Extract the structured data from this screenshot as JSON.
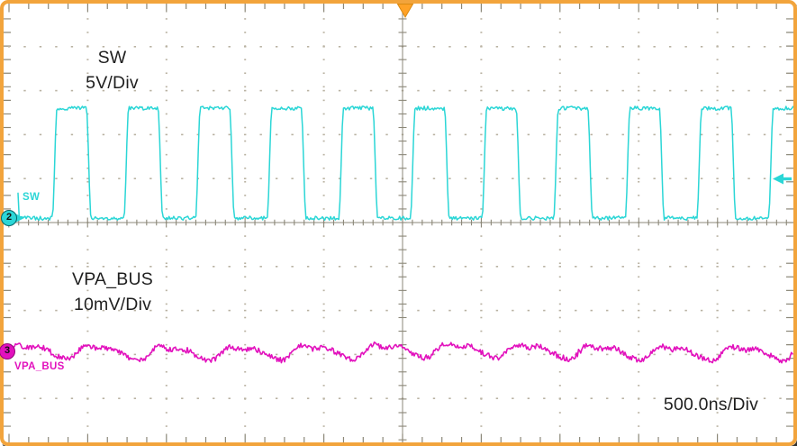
{
  "labels": {
    "ch2_annotation_line1": "SW",
    "ch2_annotation_line2": "5V/Div",
    "ch3_annotation_line1": "VPA_BUS",
    "ch3_annotation_line2": "10mV/Div",
    "timebase": "500.0ns/Div",
    "ch2_trace_label": "SW",
    "ch3_trace_label": "VPA_BUS",
    "ch2_marker": "2",
    "ch3_marker": "3"
  },
  "colors": {
    "ch2": "#2bd6d6",
    "ch3": "#e211bd",
    "frame": "#f2a43c",
    "trigger": "#ffa226",
    "trigger-edge": "#d98a12",
    "grid-tick": "#8b8778",
    "grid-dot": "#b9b2a2",
    "text": "#1f1f1f"
  },
  "chart_data": {
    "type": "line",
    "title": "Oscilloscope capture: SW switching node and VPA_BUS ripple",
    "x_axis": {
      "scale_per_div": "500.0ns/Div",
      "divisions": 10
    },
    "y_axis": {
      "divisions": 10
    },
    "grid": "dotted division lines with ticked center axes",
    "legend_position": "on-plot text annotations",
    "trigger": {
      "source": "SW",
      "horizontal_position_div_from_center": 0,
      "level_marker_div_above_center": 1.0
    },
    "series": [
      {
        "name": "SW",
        "channel": 2,
        "scale_per_div": "5V/Div",
        "waveform": "square",
        "period_div": 0.91,
        "period_ns_approx": 455,
        "duty_cycle_high": 0.41,
        "amplitude_div": 2.5,
        "amplitude_v_approx": 12.5,
        "baseline_div_below_center": 0.1,
        "rising_edge_offset_div_right_of_center": 0.1,
        "edge_width_div": 0.06,
        "flat_noise_pp_div": 0.09
      },
      {
        "name": "VPA_BUS",
        "channel": 3,
        "scale_per_div": "10mV/Div",
        "waveform": "periodic ripple + noise",
        "baseline_div_below_center": 2.93,
        "ripple_period_div": 0.91,
        "ripple_pp_div": 0.35,
        "ripple_pp_mv_approx": 3.5,
        "noise_pp_div": 0.12
      }
    ]
  }
}
